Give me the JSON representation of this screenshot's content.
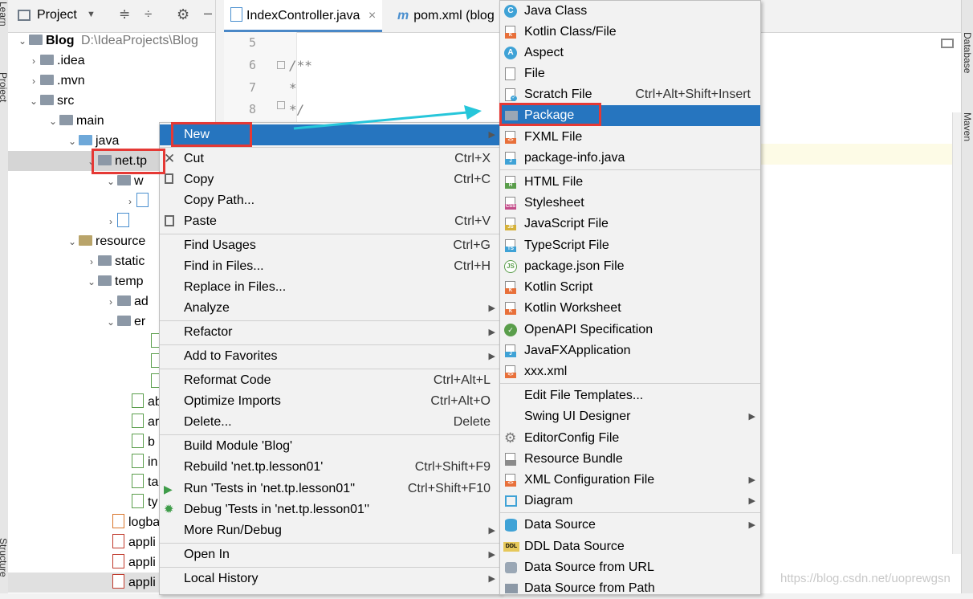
{
  "window": {
    "left_stripe_labels": [
      "Learn",
      "Project",
      "Structure"
    ],
    "right_stripe_labels": [
      "Database",
      "Maven"
    ]
  },
  "project_panel": {
    "title": "Project",
    "root_name": "Blog",
    "root_path": "D:\\IdeaProjects\\Blog",
    "items": [
      {
        "label": ".idea"
      },
      {
        "label": ".mvn"
      },
      {
        "label": "src"
      },
      {
        "label": "main"
      },
      {
        "label": "java"
      },
      {
        "label": "net.tp"
      },
      {
        "label": "w"
      },
      {
        "label": "resource"
      },
      {
        "label": "static"
      },
      {
        "label": "temp"
      },
      {
        "label": "ad"
      },
      {
        "label": "er"
      },
      {
        "label": "ab"
      },
      {
        "label": "ar"
      },
      {
        "label": "b"
      },
      {
        "label": "in"
      },
      {
        "label": "ta"
      },
      {
        "label": "ty"
      },
      {
        "label": "logba"
      },
      {
        "label": "appli"
      },
      {
        "label": "appli"
      },
      {
        "label": "appli"
      }
    ]
  },
  "editor": {
    "tabs": [
      {
        "label": "IndexController.java",
        "close": "×"
      },
      {
        "label": "pom.xml (blog"
      }
    ],
    "lines": [
      {
        "no": "5",
        "text": ""
      },
      {
        "no": "6",
        "text": "/**"
      },
      {
        "no": "7",
        "text": " *"
      },
      {
        "no": "8",
        "text": " */"
      }
    ]
  },
  "context_menu": {
    "items": [
      {
        "label": "New",
        "shortcut": "",
        "submenu": true
      },
      {
        "label": "Cut",
        "shortcut": "Ctrl+X"
      },
      {
        "label": "Copy",
        "shortcut": "Ctrl+C"
      },
      {
        "label": "Copy Path...",
        "shortcut": ""
      },
      {
        "label": "Paste",
        "shortcut": "Ctrl+V"
      },
      {
        "label": "Find Usages",
        "shortcut": "Ctrl+G"
      },
      {
        "label": "Find in Files...",
        "shortcut": "Ctrl+H"
      },
      {
        "label": "Replace in Files...",
        "shortcut": ""
      },
      {
        "label": "Analyze",
        "shortcut": "",
        "submenu": true
      },
      {
        "label": "Refactor",
        "shortcut": "",
        "submenu": true
      },
      {
        "label": "Add to Favorites",
        "shortcut": "",
        "submenu": true
      },
      {
        "label": "Reformat Code",
        "shortcut": "Ctrl+Alt+L"
      },
      {
        "label": "Optimize Imports",
        "shortcut": "Ctrl+Alt+O"
      },
      {
        "label": "Delete...",
        "shortcut": "Delete"
      },
      {
        "label": "Build Module 'Blog'",
        "shortcut": ""
      },
      {
        "label": "Rebuild 'net.tp.lesson01'",
        "shortcut": "Ctrl+Shift+F9"
      },
      {
        "label": "Run 'Tests in 'net.tp.lesson01''",
        "shortcut": "Ctrl+Shift+F10"
      },
      {
        "label": "Debug 'Tests in 'net.tp.lesson01''",
        "shortcut": ""
      },
      {
        "label": "More Run/Debug",
        "shortcut": "",
        "submenu": true
      },
      {
        "label": "Open In",
        "shortcut": "",
        "submenu": true
      },
      {
        "label": "Local History",
        "shortcut": "",
        "submenu": true
      }
    ]
  },
  "new_submenu": {
    "items": [
      {
        "label": "Java Class",
        "shortcut": ""
      },
      {
        "label": "Kotlin Class/File",
        "shortcut": ""
      },
      {
        "label": "Aspect",
        "shortcut": ""
      },
      {
        "label": "File",
        "shortcut": ""
      },
      {
        "label": "Scratch File",
        "shortcut": "Ctrl+Alt+Shift+Insert"
      },
      {
        "label": "Package",
        "shortcut": ""
      },
      {
        "label": "FXML File",
        "shortcut": ""
      },
      {
        "label": "package-info.java",
        "shortcut": ""
      },
      {
        "label": "HTML File",
        "shortcut": ""
      },
      {
        "label": "Stylesheet",
        "shortcut": ""
      },
      {
        "label": "JavaScript File",
        "shortcut": ""
      },
      {
        "label": "TypeScript File",
        "shortcut": ""
      },
      {
        "label": "package.json File",
        "shortcut": ""
      },
      {
        "label": "Kotlin Script",
        "shortcut": ""
      },
      {
        "label": "Kotlin Worksheet",
        "shortcut": ""
      },
      {
        "label": "OpenAPI Specification",
        "shortcut": ""
      },
      {
        "label": "JavaFXApplication",
        "shortcut": ""
      },
      {
        "label": "xxx.xml",
        "shortcut": ""
      },
      {
        "label": "Edit File Templates...",
        "shortcut": ""
      },
      {
        "label": "Swing UI Designer",
        "shortcut": "",
        "submenu": true
      },
      {
        "label": "EditorConfig File",
        "shortcut": ""
      },
      {
        "label": "Resource Bundle",
        "shortcut": ""
      },
      {
        "label": "XML Configuration File",
        "shortcut": "",
        "submenu": true
      },
      {
        "label": "Diagram",
        "shortcut": "",
        "submenu": true
      },
      {
        "label": "Data Source",
        "shortcut": "",
        "submenu": true
      },
      {
        "label": "DDL Data Source",
        "shortcut": ""
      },
      {
        "label": "Data Source from URL",
        "shortcut": ""
      },
      {
        "label": "Data Source from Path",
        "shortcut": ""
      }
    ]
  },
  "watermark": "https://blog.csdn.net/uoprewgsn",
  "colors": {
    "selection": "#2675bf",
    "highlight_box": "#e53935",
    "annotation_arrow": "#26c6da"
  }
}
